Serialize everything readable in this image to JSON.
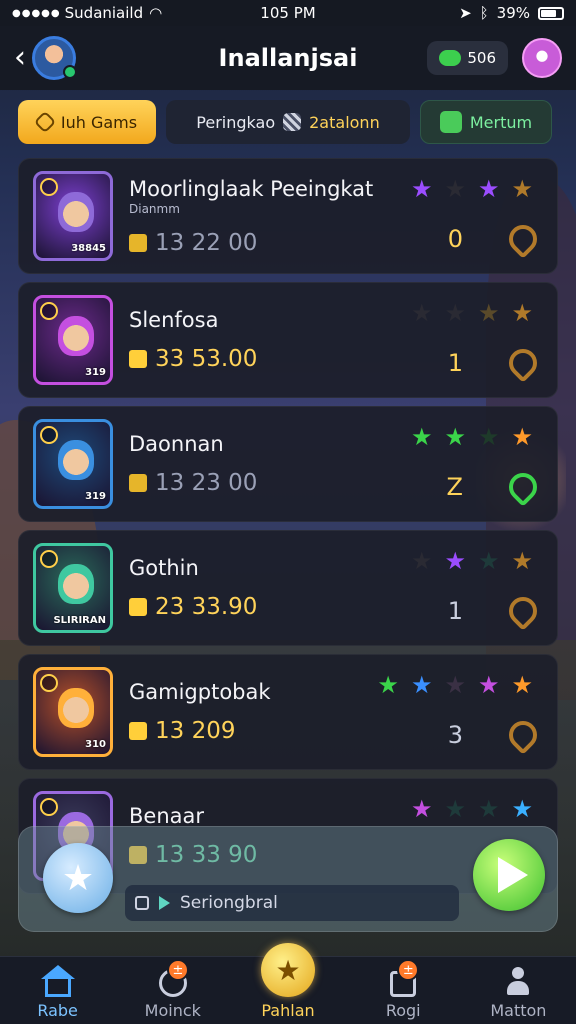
{
  "status_bar": {
    "signal": "●●●●●",
    "carrier": "Sudaniaild",
    "time": "105 PM",
    "battery": "39%"
  },
  "header": {
    "title": "Inallanjsai",
    "coins": "506"
  },
  "tabs": [
    {
      "label": "Iuh Gams"
    },
    {
      "label": "Peringkao",
      "highlight": "2atalonn"
    },
    {
      "label": "Mertum"
    }
  ],
  "cards": [
    {
      "name": "Moorlinglaak Peeingkat",
      "sub": "Dianmm",
      "value": "13 22 00",
      "rank": "0",
      "portrait_level": "38845",
      "stars": [
        "#9b4dff",
        "#2a2a33",
        "#9b4dff",
        "#b07a2a"
      ],
      "rank_color": "#ffd35a",
      "value_color": "#9aa0b6",
      "frame_color": "#8e6ad8",
      "bg": "#7c3fd0"
    },
    {
      "name": "Slenfosa",
      "sub": "",
      "value": "33 53.00",
      "rank": "1",
      "portrait_level": "319",
      "stars": [
        "#2a2a33",
        "#2a2a33",
        "#5a4a2a",
        "#b07a2a"
      ],
      "rank_color": "#ffd35a",
      "value_color": "#ffd35a",
      "frame_color": "#c44fe0",
      "bg": "#6b2a8a"
    },
    {
      "name": "Daonnan",
      "sub": "",
      "value": "13 23 00",
      "rank": "Z",
      "portrait_level": "319",
      "stars": [
        "#3bd44a",
        "#3bd44a",
        "#1e3a2a",
        "#ff9a2a"
      ],
      "rank_color": "#ffd35a",
      "value_color": "#9aa0b6",
      "frame_color": "#3a8fe0",
      "bg": "#1e4a7a"
    },
    {
      "name": "Gothin",
      "sub": "",
      "value": "23 33.90",
      "rank": "1",
      "portrait_level": "SLIRIRAN",
      "stars": [
        "#2a2a33",
        "#9b4dff",
        "#1e3a3a",
        "#b07a2a"
      ],
      "rank_color": "#c9cede",
      "value_color": "#ffd35a",
      "frame_color": "#3fc8a0",
      "bg": "#2a6a5a"
    },
    {
      "name": "Gamigptobak",
      "sub": "",
      "value": "13 209",
      "rank": "3",
      "portrait_level": "310",
      "stars": [
        "#3bd44a",
        "#3a8fff",
        "#3a3044",
        "#c44fe0",
        "#ff9a2a"
      ],
      "rank_color": "#c9cede",
      "value_color": "#ffd35a",
      "frame_color": "#ffb03a",
      "bg": "#b5502a"
    },
    {
      "name": "Benaar",
      "sub": "",
      "value": "13 33 90",
      "rank": "",
      "portrait_level": "",
      "stars": [
        "#c44fe0",
        "#1e3a3a",
        "#1e3a3a",
        "#3ab0ff"
      ],
      "rank_color": "#c9cede",
      "value_color": "#6fe0b0",
      "frame_color": "#9b6ae0",
      "bg": "#3a3a5a"
    }
  ],
  "action_bar": {
    "search_text": "Seriongbral"
  },
  "nav": [
    {
      "label": "Rabe"
    },
    {
      "label": "Moinck",
      "badge": "±"
    },
    {
      "label": "Pahlan"
    },
    {
      "label": "Rogi",
      "badge": "±"
    },
    {
      "label": "Matton"
    }
  ],
  "colors": {
    "accent": "#ffd35a",
    "active_nav": "#7cc3ff",
    "play": "#3bbf2e"
  }
}
